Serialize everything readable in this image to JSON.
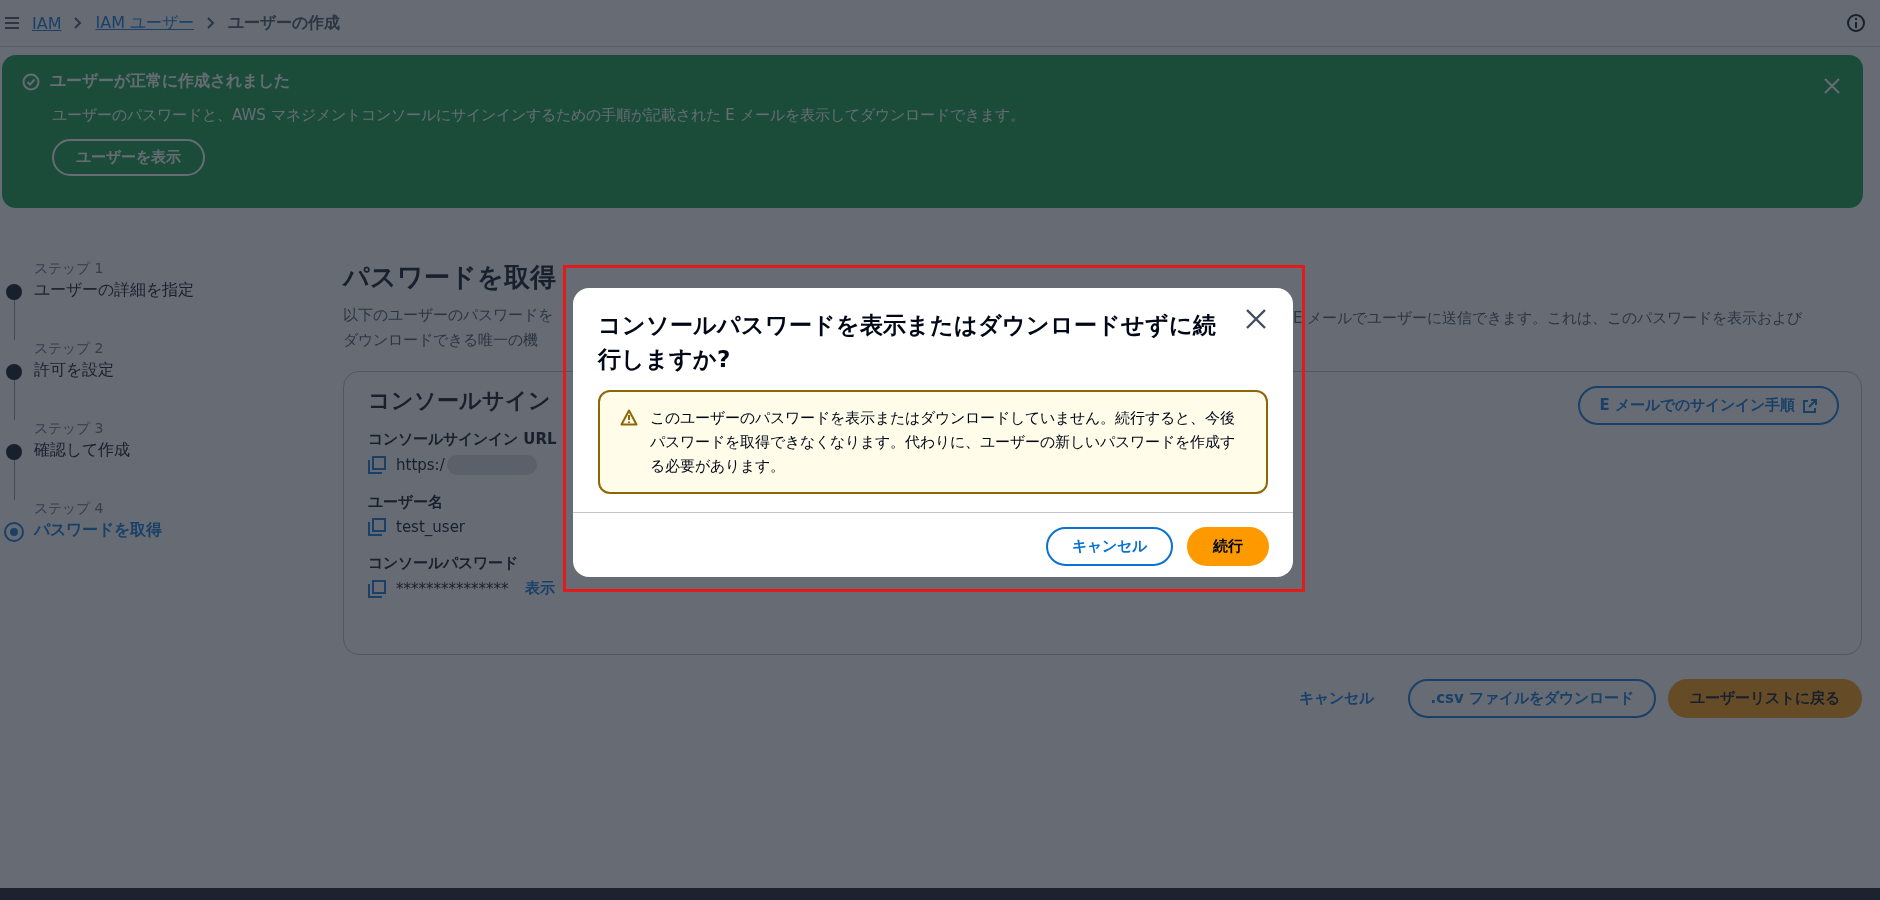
{
  "breadcrumbs": [
    {
      "label": "IAM",
      "link": true
    },
    {
      "label": "IAM ユーザー",
      "link": true
    },
    {
      "label": "ユーザーの作成",
      "link": false
    }
  ],
  "banner": {
    "title": "ユーザーが正常に作成されました",
    "message": "ユーザーのパスワードと、AWS マネジメントコンソールにサインインするための手順が記載された E メールを表示してダウンロードできます。",
    "button": "ユーザーを表示"
  },
  "steps": [
    {
      "step": "ステップ 1",
      "title": "ユーザーの詳細を指定",
      "selected": false
    },
    {
      "step": "ステップ 2",
      "title": "許可を設定",
      "selected": false
    },
    {
      "step": "ステップ 3",
      "title": "確認して作成",
      "selected": false
    },
    {
      "step": "ステップ 4",
      "title": "パスワードを取得",
      "selected": true
    }
  ],
  "page": {
    "heading": "パスワードを取得",
    "description_left": [
      "以下のユーザーのパスワードを",
      "ダウンロードできる唯一の機"
    ],
    "description_right": "E メールでユーザーに送信できます。これは、このパスワードを表示および"
  },
  "card": {
    "title": "コンソールサイン",
    "email_button": "E メールでのサインイン手順",
    "fields": [
      {
        "label": "コンソールサインイン URL",
        "value": "https:/",
        "kind": "redacted"
      },
      {
        "label": "ユーザー名",
        "value": "test_user",
        "kind": "plain"
      },
      {
        "label": "コンソールパスワード",
        "value": "***************",
        "kind": "secret",
        "action": "表示"
      }
    ]
  },
  "actions": [
    {
      "label": "キャンセル",
      "kind": "link"
    },
    {
      "label": ".csv ファイルをダウンロード",
      "kind": "secondary"
    },
    {
      "label": "ユーザーリストに戻る",
      "kind": "primary"
    }
  ],
  "modal": {
    "title": "コンソールパスワードを表示またはダウンロードせずに続行しますか?",
    "warning": "このユーザーのパスワードを表示またはダウンロードしていません。続行すると、今後パスワードを取得できなくなります。代わりに、ユーザーの新しいパスワードを作成する必要があります。",
    "buttons": [
      {
        "label": "キャンセル",
        "kind": "secondary"
      },
      {
        "label": "続行",
        "kind": "primary"
      }
    ]
  }
}
